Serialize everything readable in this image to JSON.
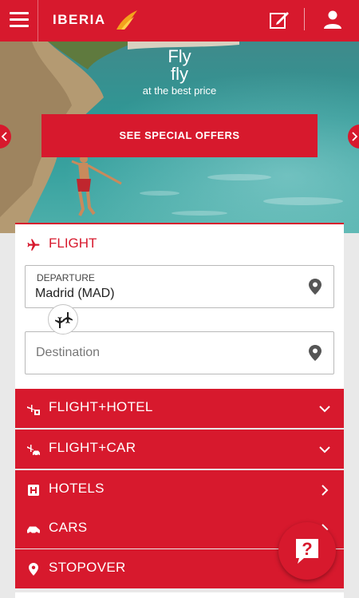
{
  "header": {
    "brand": "IBERIA",
    "icons": {
      "menu": "hamburger-menu-icon",
      "edit": "edit-pencil-icon",
      "user": "user-icon"
    },
    "colors": {
      "primary": "#d7192d",
      "logo_orange": "#f3a21c"
    }
  },
  "hero": {
    "line1": "Fly",
    "line2": "fly",
    "subtitle": "at the best price",
    "offers_label": "SEE SPECIAL OFFERS"
  },
  "search": {
    "tab_label": "FLIGHT",
    "departure_label": "DEPARTURE",
    "departure_value": "Madrid (MAD)",
    "destination_placeholder": "Destination"
  },
  "products": [
    {
      "label": "FLIGHT+HOTEL",
      "icon": "flight-hotel-icon",
      "chevron": "down"
    },
    {
      "label": "FLIGHT+CAR",
      "icon": "flight-car-icon",
      "chevron": "down"
    },
    {
      "label": "HOTELS",
      "icon": "hotel-icon",
      "chevron": "right"
    },
    {
      "label": "CARS",
      "icon": "car-icon",
      "chevron": "right"
    },
    {
      "label": "STOPOVER",
      "icon": "location-pin-icon",
      "chevron": "none"
    }
  ],
  "help": {
    "symbol": "?",
    "icon": "help-chat-icon"
  }
}
